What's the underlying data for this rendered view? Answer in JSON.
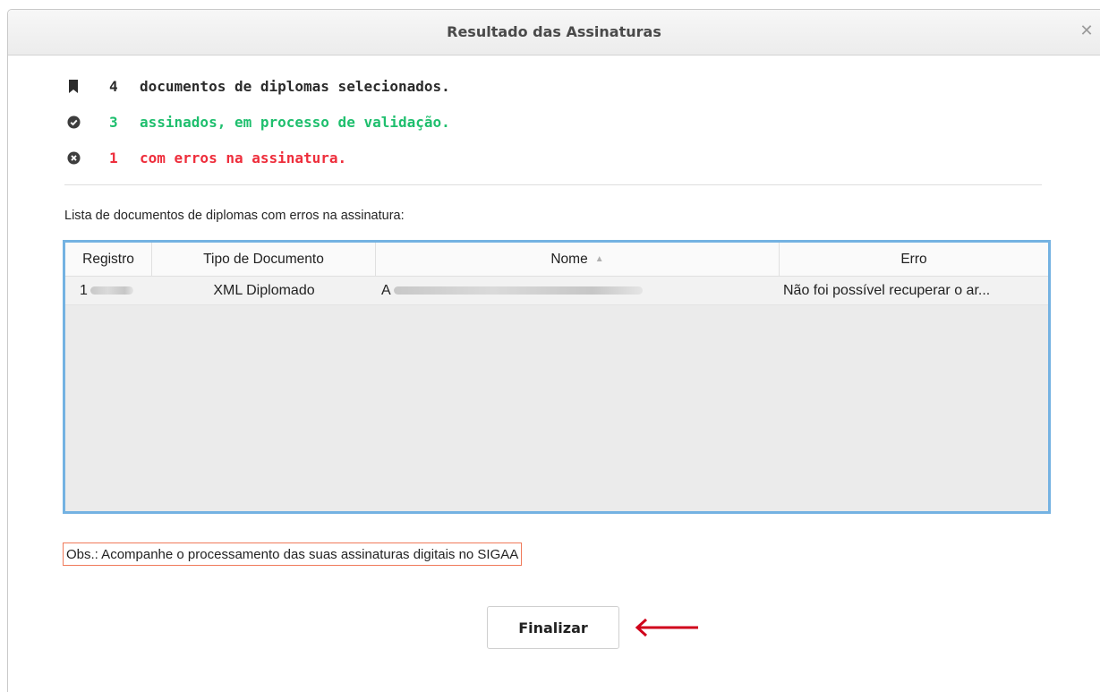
{
  "dialog": {
    "title": "Resultado das Assinaturas",
    "close_icon": "close-icon"
  },
  "summary": {
    "total": {
      "icon": "bookmark-icon",
      "count": "4",
      "text": "documentos de diplomas selecionados.",
      "color": "#2b2b2b"
    },
    "signed": {
      "icon": "check-circle-icon",
      "count": "3",
      "text": "assinados, em processo de validação.",
      "color": "#1fbf6e"
    },
    "errors": {
      "icon": "x-circle-icon",
      "count": "1",
      "text": "com erros na assinatura.",
      "color": "#ee2e3c"
    }
  },
  "list": {
    "label": "Lista de documentos de diplomas com erros na assinatura:",
    "columns": [
      "Registro",
      "Tipo de Documento",
      "Nome",
      "Erro"
    ],
    "sorted_column": "Nome",
    "sort_icon": "sort-ascending-icon",
    "rows": [
      {
        "registro": "1",
        "tipo": "XML Diplomado",
        "nome": "A",
        "erro": "Não foi possível recuperar o ar..."
      }
    ]
  },
  "obs": "Obs.: Acompanhe o processamento das suas assinaturas digitais no SIGAA",
  "actions": {
    "finalize_label": "Finalizar",
    "arrow_color": "#d0021b"
  },
  "colors": {
    "table_border": "#74b2e2",
    "obs_border": "#f07a5a"
  }
}
